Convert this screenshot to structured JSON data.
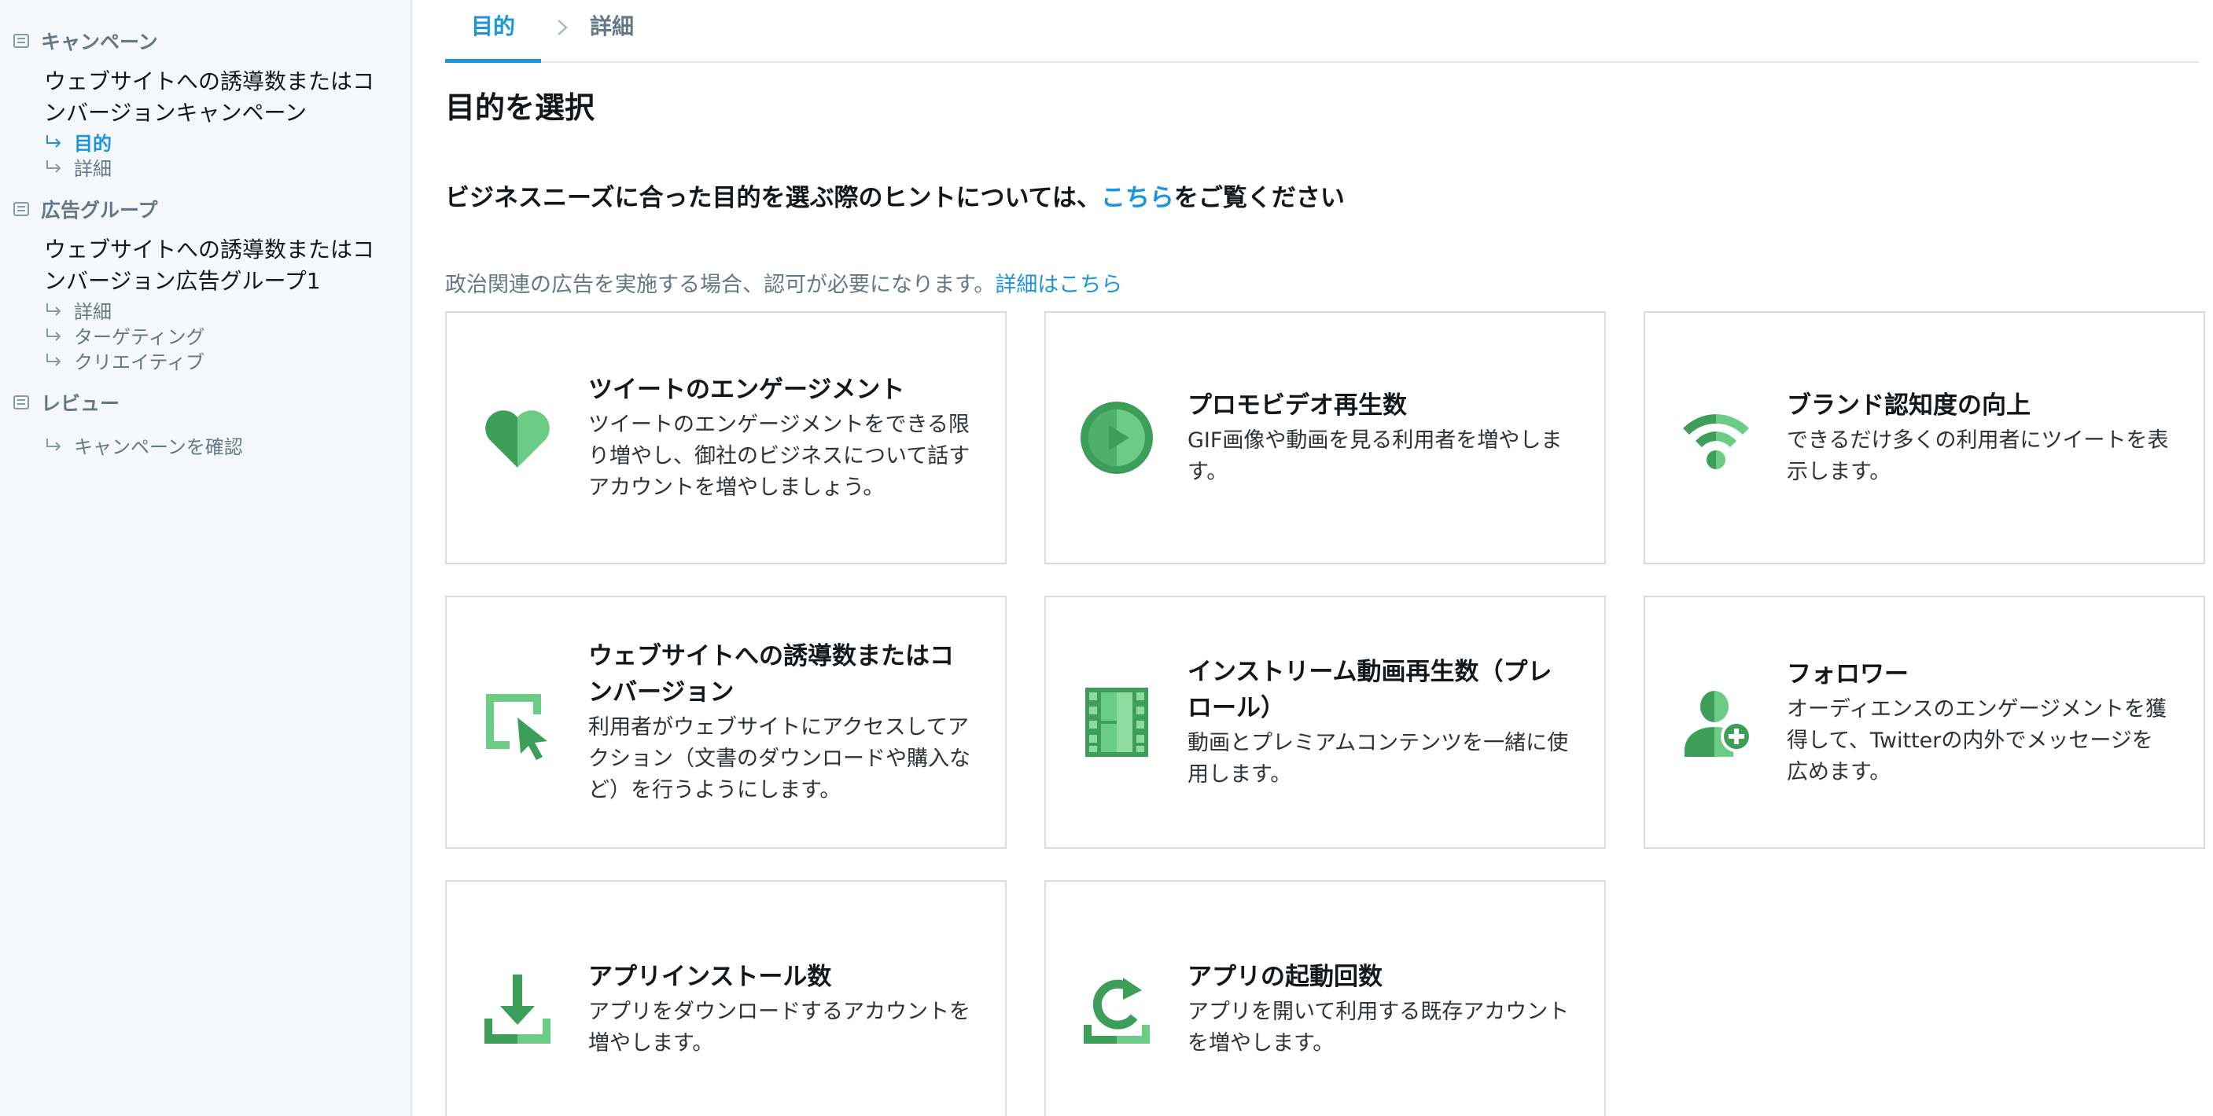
{
  "sidebar": {
    "campaign": {
      "heading": "キャンペーン",
      "name": "ウェブサイトへの誘導数またはコンバージョンキャンペーン",
      "items": [
        {
          "label": "目的",
          "active": true
        },
        {
          "label": "詳細",
          "active": false
        }
      ]
    },
    "ad_group": {
      "heading": "広告グループ",
      "name": "ウェブサイトへの誘導数またはコンバージョン広告グループ1",
      "items": [
        {
          "label": "詳細"
        },
        {
          "label": "ターゲティング"
        },
        {
          "label": "クリエイティブ"
        }
      ]
    },
    "review": {
      "heading": "レビュー",
      "items": [
        {
          "label": "キャンペーンを確認"
        }
      ]
    }
  },
  "tabs": {
    "objective": "目的",
    "details": "詳細"
  },
  "page_title": "目的を選択",
  "hint": {
    "before": "ビジネスニーズに合った目的を選ぶ際のヒントについては、",
    "link": "こちら",
    "after": "をご覧ください"
  },
  "notice": {
    "text": "政治関連の広告を実施する場合、認可が必要になります。",
    "link": "詳細はこちら"
  },
  "objectives": [
    {
      "title": "ツイートのエンゲージメント",
      "description": "ツイートのエンゲージメントをできる限り増やし、御社のビジネスについて話すアカウントを増やしましょう。",
      "icon": "heart-icon"
    },
    {
      "title": "プロモビデオ再生数",
      "description": "GIF画像や動画を見る利用者を増やします。",
      "icon": "play-video-icon"
    },
    {
      "title": "ブランド認知度の向上",
      "description": "できるだけ多くの利用者にツイートを表示します。",
      "icon": "broadcast-icon"
    },
    {
      "title": "ウェブサイトへの誘導数またはコンバージョン",
      "description": "利用者がウェブサイトにアクセスしてアクション（文書のダウンロードや購入など）を行うようにします。",
      "icon": "cursor-click-icon"
    },
    {
      "title": "インストリーム動画再生数（プレロール）",
      "description": "動画とプレミアムコンテンツを一緒に使用します。",
      "icon": "film-strip-icon"
    },
    {
      "title": "フォロワー",
      "description": "オーディエンスのエンゲージメントを獲得して、Twitterの内外でメッセージを広めます。",
      "icon": "add-follower-icon"
    },
    {
      "title": "アプリインストール数",
      "description": "アプリをダウンロードするアカウントを増やします。",
      "icon": "download-icon"
    },
    {
      "title": "アプリの起動回数",
      "description": "アプリを開いて利用する既存アカウントを増やします。",
      "icon": "app-reengage-icon"
    }
  ],
  "colors": {
    "accent_blue": "#1b95e0",
    "icon_green_dark": "#3d9e5a",
    "icon_green_light": "#6ccb85",
    "sidebar_bg": "#f5f8fa",
    "border": "#d7dce0"
  }
}
